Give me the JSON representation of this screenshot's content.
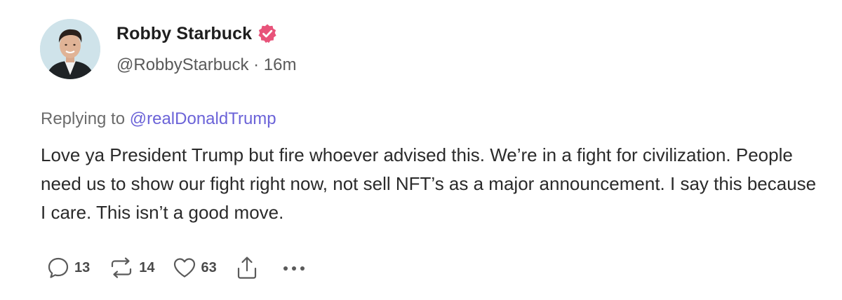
{
  "post": {
    "author": {
      "display_name": "Robby Starbuck",
      "handle": "@RobbyStarbuck",
      "separator": "·",
      "time_ago": "16m",
      "verified": true
    },
    "replying_to": {
      "prefix": "Replying to",
      "mention": "@realDonaldTrump"
    },
    "body": "Love ya President Trump but fire whoever advised this. We’re in a fight for civilization. People need us to show our fight right now, not sell NFT’s as a major announcement. I say this because I care. This isn’t a good move.",
    "actions": {
      "reply_count": "13",
      "repost_count": "14",
      "like_count": "63"
    }
  },
  "icons": {
    "verified": "verified-badge-icon",
    "reply": "comment-bubble-icon",
    "repost": "repost-icon",
    "like": "heart-icon",
    "share": "share-upload-icon",
    "more": "more-dots-icon"
  },
  "colors": {
    "verified_badge": "#e8537a",
    "mention": "#6b63d8",
    "icon": "#5a5a5a"
  }
}
